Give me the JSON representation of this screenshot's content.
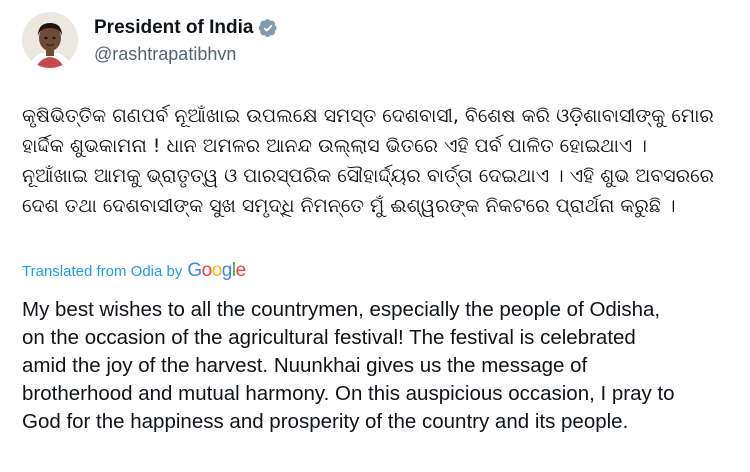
{
  "author": {
    "display_name": "President of India",
    "handle": "@rashtrapatibhvn",
    "avatar_icon": "user-avatar-photo",
    "verified_icon": "verified-badge-icon",
    "verified_color": "#829aab"
  },
  "tweet": {
    "original_text": "କୃଷିଭିତ୍ତିକ ଗଣପର୍ବ ନୂଆଁଖାଇ ଉପଲକ୍ଷେ ସମସ୍ତ ଦେଶବାସୀ, ବିଶେଷ କରି ଓଡ଼ିଶାବାସୀଙ୍କୁ ମୋର\nହାର୍ଦ୍ଦିକ ଶୁଭକାମନା ! ଧାନ ଅମଳର ଆନନ୍ଦ ଉଲ୍ଲାସ ଭିତରେ ଏହି ପର୍ବ ପାଳିତ ହୋଇଥାଏ ।\nନୂଆଁଖାଇ ଆମକୁ ଭ୍ରାତୃତ୍ୱ ଓ ପାରସ୍ପରିକ ସୌହାର୍ଦ୍ଦ୍ୟର ବାର୍ତ୍ତା ଦେଇଥାଏ । ଏହି ଶୁଭ ଅବସରରେ\nଦେଶ ତଥା ଦେଶବାସୀଙ୍କ ସୁଖ ସମୃଦ୍ଧି ନିମନ୍ତେ ମୁଁ ଈଶ୍ୱରଙ୍କ ନିକଟରେ ପ୍ରାର୍ଥନା କରୁଛି ।",
    "translated_label": "Translated from Odia by",
    "translation_provider": {
      "letters": [
        "G",
        "o",
        "o",
        "g",
        "l",
        "e"
      ]
    },
    "translation": "My best wishes to all the countrymen, especially the people of Odisha,\non the occasion of the agricultural festival! The festival is celebrated\namid the joy of the harvest. Nuunkhai gives us the message of\nbrotherhood and mutual harmony. On this auspicious occasion, I pray to\nGod for the happiness and prosperity of the country and its people."
  },
  "colors": {
    "text": "#0f1419",
    "secondary_text": "#536471",
    "link": "#1d9bf0"
  }
}
